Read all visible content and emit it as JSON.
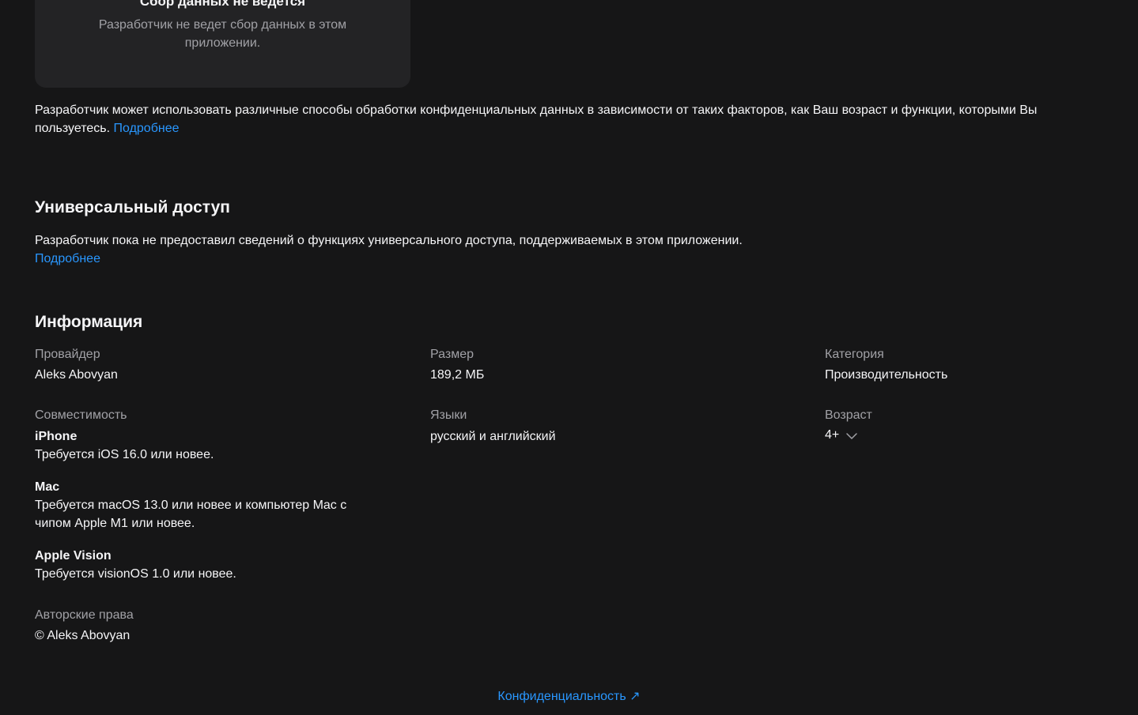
{
  "privacy_card": {
    "title": "Сбор данных не ведется",
    "text": "Разработчик не ведет сбор данных в этом приложении."
  },
  "privacy_note": {
    "text": "Разработчик может использовать различные способы обработки конфиденциальных данных в зависимости от таких факторов, как Ваш возраст и функции, которыми Вы пользуетесь.",
    "link": "Подробнее"
  },
  "accessibility": {
    "title": "Универсальный доступ",
    "text": "Разработчик пока не предоставил сведений о функциях универсального доступа, поддерживаемых в этом приложении.",
    "link": "Подробнее"
  },
  "information": {
    "title": "Информация",
    "provider": {
      "label": "Провайдер",
      "value": "Aleks Abovyan"
    },
    "size": {
      "label": "Размер",
      "value": "189,2 МБ"
    },
    "category": {
      "label": "Категория",
      "value": "Производительность"
    },
    "compatibility": {
      "label": "Совместимость",
      "devices": [
        {
          "name": "iPhone",
          "requirement": "Требуется iOS 16.0 или новее."
        },
        {
          "name": "Mac",
          "requirement": "Требуется macOS 13.0 или новее и компьютер Mac с чипом Apple M1 или новее."
        },
        {
          "name": "Apple Vision",
          "requirement": "Требуется visionOS 1.0 или новее."
        }
      ]
    },
    "languages": {
      "label": "Языки",
      "value": "русский и английский"
    },
    "age": {
      "label": "Возраст",
      "value": "4+"
    },
    "copyright": {
      "label": "Авторские права",
      "value": "© Aleks Abovyan"
    }
  },
  "footer": {
    "privacy_link": "Конфиденциальность ↗"
  },
  "colors": {
    "background": "#161617",
    "card": "#232325",
    "link": "#2997ff",
    "secondary_text": "#a1a1a6"
  }
}
